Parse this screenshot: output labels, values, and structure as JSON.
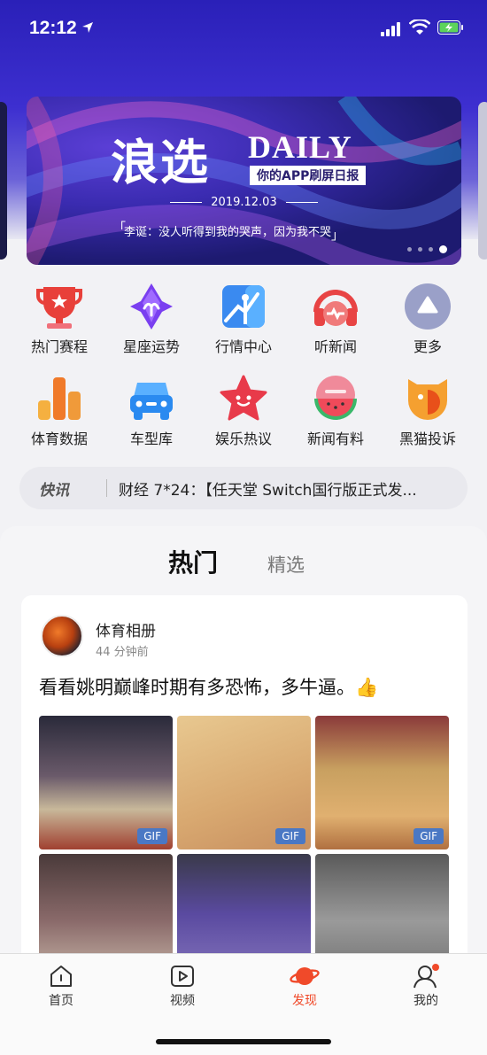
{
  "status_bar": {
    "time": "12:12"
  },
  "banner": {
    "title": "浪选",
    "daily": "DAILY",
    "subtitle": "你的APP刷屏日报",
    "date": "2019.12.03",
    "quote": "李诞：没人听得到我的哭声，因为我不哭"
  },
  "grid": {
    "items": [
      {
        "label": "热门赛程",
        "icon": "trophy-icon",
        "color": "#e8403a"
      },
      {
        "label": "星座运势",
        "icon": "horoscope-star-icon",
        "color": "#7a3ff0"
      },
      {
        "label": "行情中心",
        "icon": "chart-icon",
        "color": "#3a8af0"
      },
      {
        "label": "听新闻",
        "icon": "headphones-icon",
        "color": "#e84444"
      },
      {
        "label": "更多",
        "icon": "more-icon",
        "color": "#9aa0c8"
      },
      {
        "label": "体育数据",
        "icon": "bar-data-icon",
        "color": "#f07a2a"
      },
      {
        "label": "车型库",
        "icon": "car-icon",
        "color": "#2a8af0"
      },
      {
        "label": "娱乐热议",
        "icon": "star-face-icon",
        "color": "#e83a4a"
      },
      {
        "label": "新闻有料",
        "icon": "watermelon-icon",
        "color": "#e84a5a"
      },
      {
        "label": "黑猫投诉",
        "icon": "black-cat-shield-icon",
        "color": "#f08a2a"
      }
    ]
  },
  "ticker": {
    "tag": "快讯",
    "text": "财经 7*24：【任天堂 Switch国行版正式发..."
  },
  "feed": {
    "tabs": [
      {
        "label": "热门"
      },
      {
        "label": "精选"
      }
    ],
    "post": {
      "author": "体育相册",
      "time_ago": "44 分钟前",
      "headline": "看看姚明巅峰时期有多恐怖，多牛逼。👍",
      "gif_badge": "GIF"
    }
  },
  "nav": {
    "items": [
      {
        "label": "首页",
        "icon": "home-icon"
      },
      {
        "label": "视频",
        "icon": "video-play-icon"
      },
      {
        "label": "发现",
        "icon": "planet-icon"
      },
      {
        "label": "我的",
        "icon": "user-icon"
      }
    ]
  },
  "colors": {
    "accent": "#f04a2a",
    "top_gradient": "#3d2fd0"
  }
}
